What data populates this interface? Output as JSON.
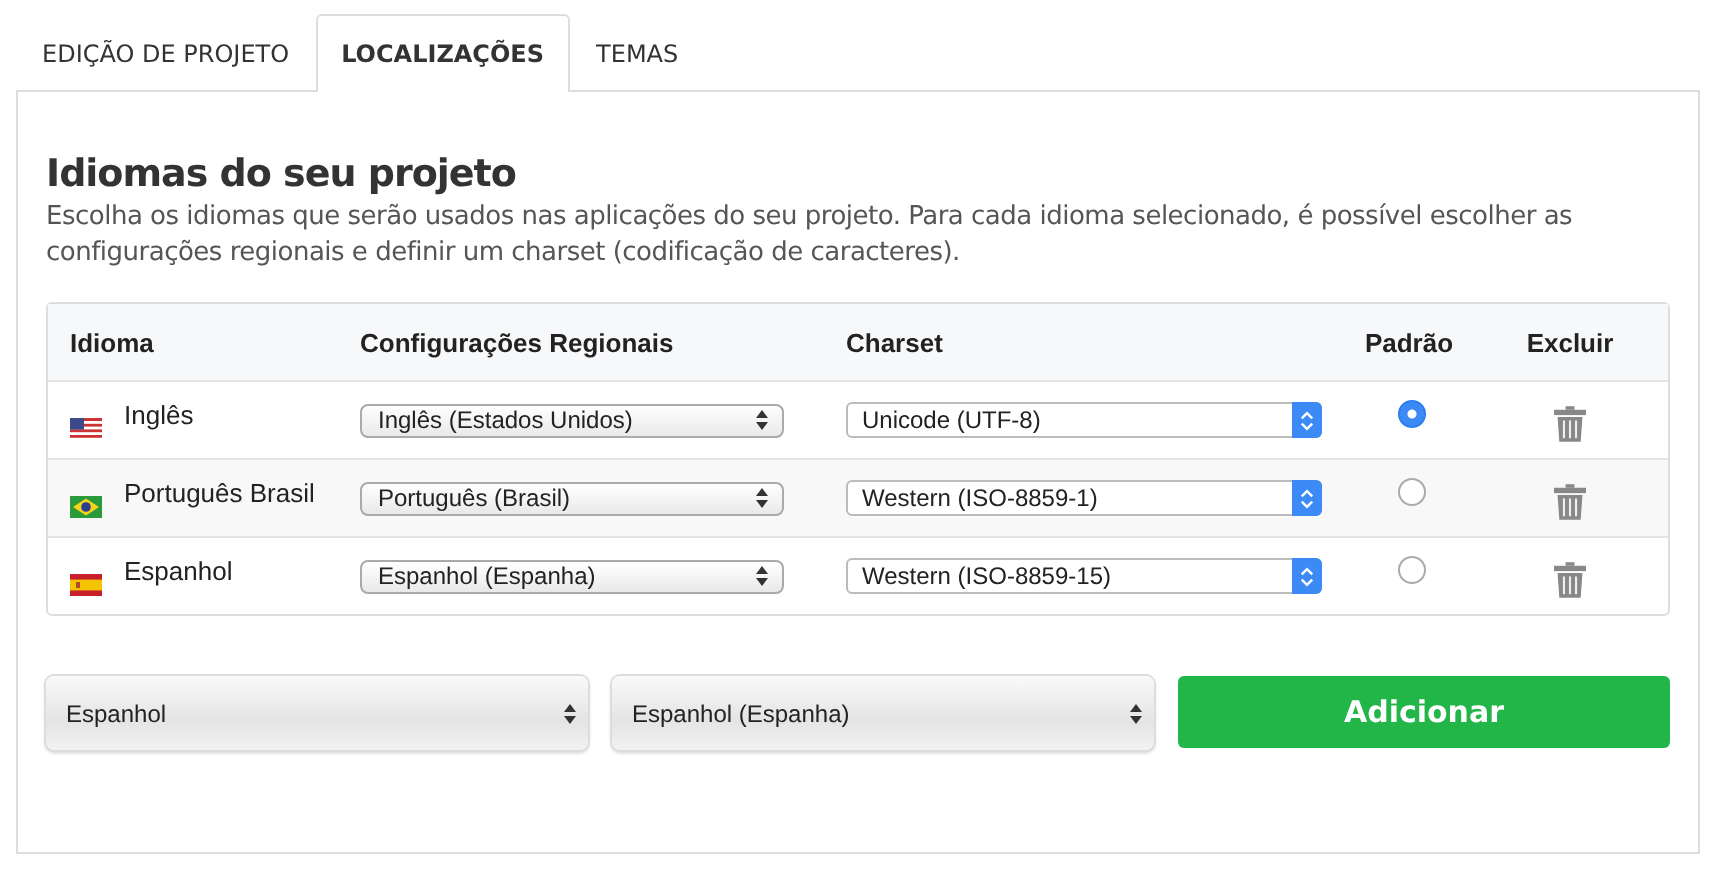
{
  "tabs": [
    {
      "label": "EDIÇÃO DE PROJETO",
      "selected": false
    },
    {
      "label": "LOCALIZAÇÕES",
      "selected": true
    },
    {
      "label": "TEMAS",
      "selected": false
    }
  ],
  "section": {
    "title": "Idiomas do seu projeto",
    "description": "Escolha os idiomas que serão usados nas aplicações do seu projeto. Para cada idioma selecionado, é possível escolher as configurações regionais e definir um charset (codificação de caracteres)."
  },
  "table": {
    "columns": [
      "Idioma",
      "Configurações Regionais",
      "Charset",
      "Padrão",
      "Excluir"
    ],
    "rows": [
      {
        "kind": "us",
        "language": "Inglês",
        "regional": "Inglês (Estados Unidos)",
        "charset": "Unicode (UTF-8)",
        "selected": true
      },
      {
        "kind": "br",
        "language": "Português Brasil",
        "regional": "Português (Brasil)",
        "charset": "Western (ISO-8859-1)",
        "selected": false
      },
      {
        "kind": "es",
        "language": "Espanhol",
        "regional": "Espanhol (Espanha)",
        "charset": "Western (ISO-8859-15)",
        "selected": false
      }
    ]
  },
  "add_form": {
    "language": "Espanhol",
    "regional": "Espanhol (Espanha)",
    "button": "Adicionar"
  }
}
